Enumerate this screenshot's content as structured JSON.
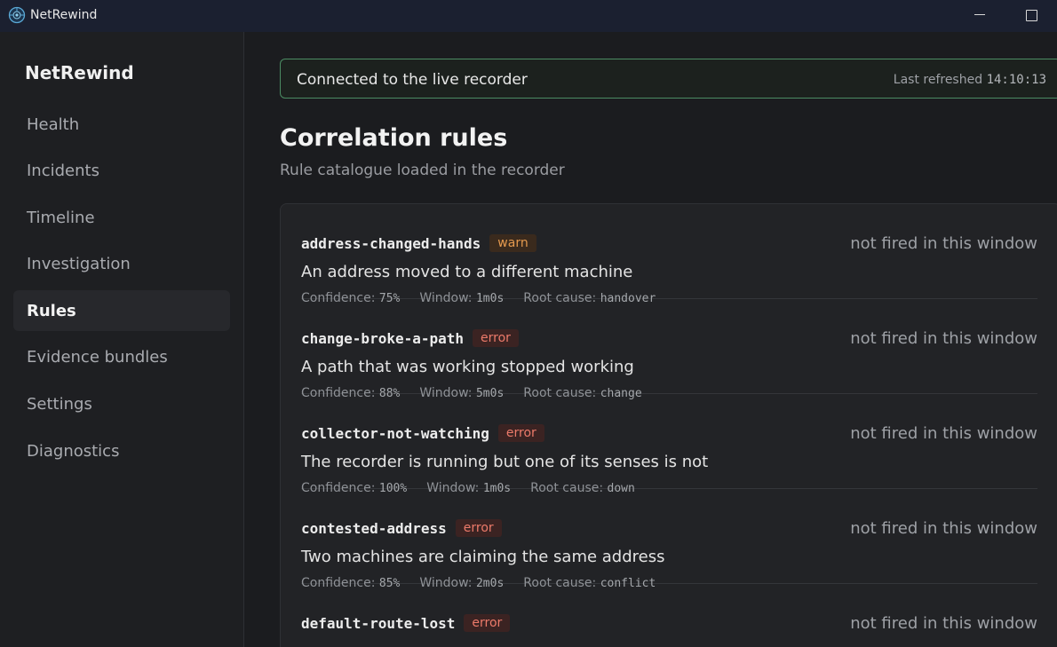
{
  "window": {
    "title": "NetRewind"
  },
  "sidebar": {
    "brand": "NetRewind",
    "items": [
      {
        "label": "Health"
      },
      {
        "label": "Incidents"
      },
      {
        "label": "Timeline"
      },
      {
        "label": "Investigation"
      },
      {
        "label": "Rules",
        "active": true
      },
      {
        "label": "Evidence bundles"
      },
      {
        "label": "Settings"
      },
      {
        "label": "Diagnostics"
      }
    ]
  },
  "status": {
    "text": "Connected to the live recorder",
    "refresh_label": "Last refreshed",
    "refresh_time": "14:10:13",
    "color": "#4b8c63"
  },
  "page": {
    "title": "Correlation rules",
    "subtitle": "Rule catalogue loaded in the recorder"
  },
  "labels": {
    "confidence": "Confidence:",
    "window": "Window:",
    "root_cause": "Root cause:"
  },
  "rules": [
    {
      "name": "address-changed-hands",
      "severity": "warn",
      "status": "not fired in this window",
      "description": "An address moved to a different machine",
      "confidence": "75%",
      "window": "1m0s",
      "root_cause": "handover"
    },
    {
      "name": "change-broke-a-path",
      "severity": "error",
      "status": "not fired in this window",
      "description": "A path that was working stopped working",
      "confidence": "88%",
      "window": "5m0s",
      "root_cause": "change"
    },
    {
      "name": "collector-not-watching",
      "severity": "error",
      "status": "not fired in this window",
      "description": "The recorder is running but one of its senses is not",
      "confidence": "100%",
      "window": "1m0s",
      "root_cause": "down"
    },
    {
      "name": "contested-address",
      "severity": "error",
      "status": "not fired in this window",
      "description": "Two machines are claiming the same address",
      "confidence": "85%",
      "window": "2m0s",
      "root_cause": "conflict"
    },
    {
      "name": "default-route-lost",
      "severity": "error",
      "status": "not fired in this window",
      "description": "",
      "confidence": "",
      "window": "",
      "root_cause": ""
    }
  ],
  "colors": {
    "warn": "#e69a4e",
    "error": "#ec7a6a",
    "accent_border": "#4b8c63"
  }
}
